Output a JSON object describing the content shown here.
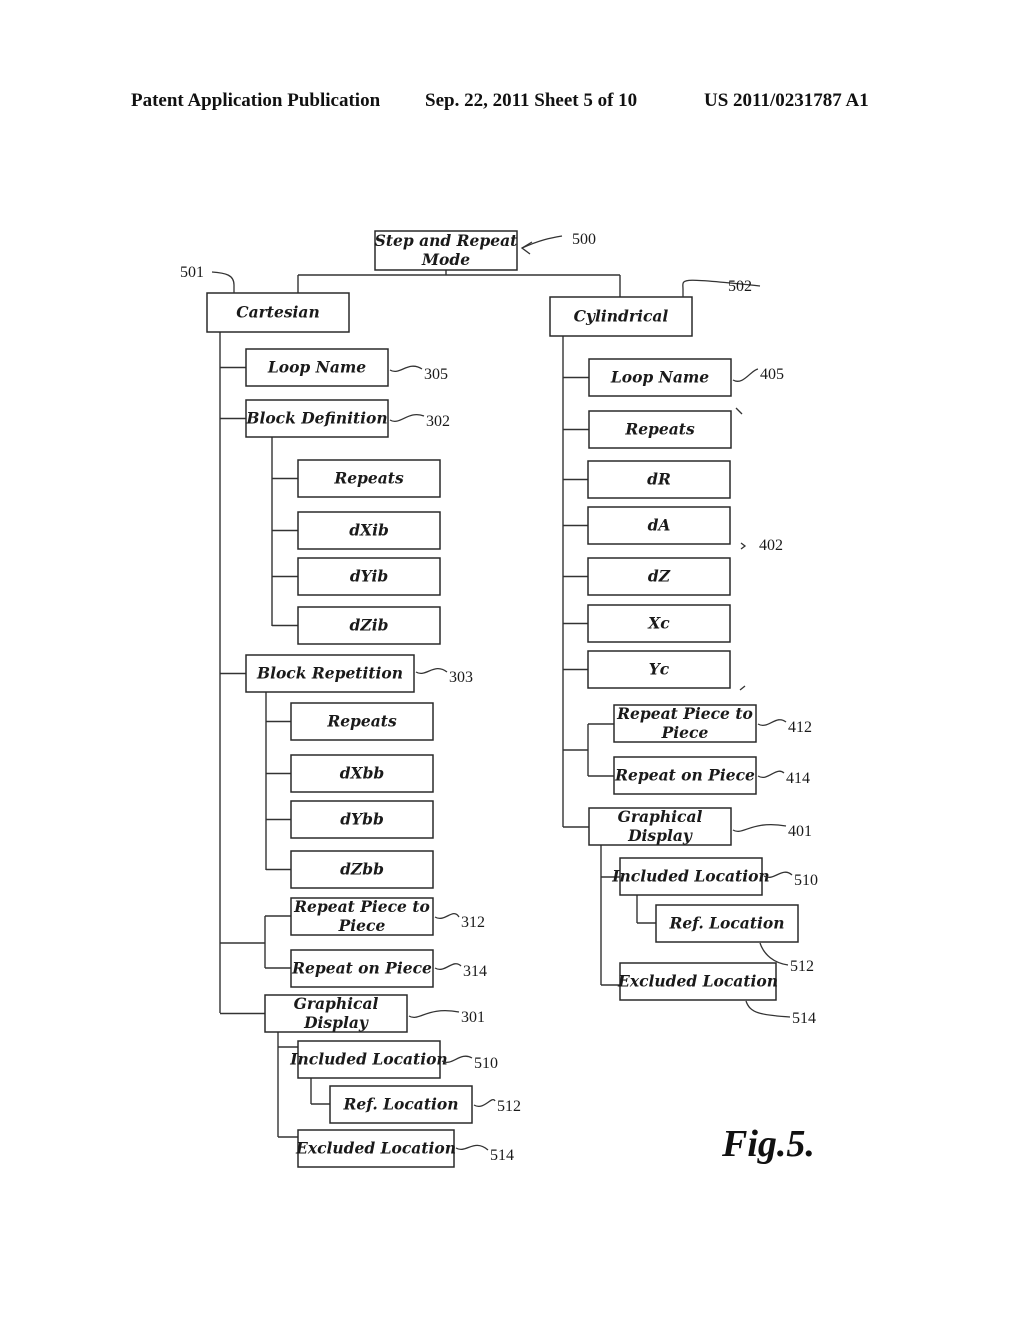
{
  "header": {
    "publication": "Patent Application Publication",
    "date_sheet": "Sep. 22, 2011   Sheet 5 of 10",
    "number": "US 2011/0231787 A1"
  },
  "figure_label": "Fig.5.",
  "diagram": {
    "root": {
      "id": "root",
      "lines": [
        "Step and Repeat",
        "Mode"
      ],
      "ref": "500"
    },
    "boxes": [
      {
        "id": "cart",
        "lines": [
          "Cartesian"
        ],
        "ref": "501"
      },
      {
        "id": "cyl",
        "lines": [
          "Cylindrical"
        ],
        "ref": "502"
      },
      {
        "id": "c-loop",
        "lines": [
          "Loop Name"
        ],
        "ref": "305"
      },
      {
        "id": "c-bdef",
        "lines": [
          "Block Definition"
        ],
        "ref": "302"
      },
      {
        "id": "c-bd-rep",
        "lines": [
          "Repeats"
        ],
        "ref": ""
      },
      {
        "id": "c-dxib",
        "lines": [
          "dXib"
        ],
        "ref": ""
      },
      {
        "id": "c-dyib",
        "lines": [
          "dYib"
        ],
        "ref": ""
      },
      {
        "id": "c-dzib",
        "lines": [
          "dZib"
        ],
        "ref": ""
      },
      {
        "id": "c-brep",
        "lines": [
          "Block Repetition"
        ],
        "ref": "303"
      },
      {
        "id": "c-br-rep",
        "lines": [
          "Repeats"
        ],
        "ref": ""
      },
      {
        "id": "c-dxbb",
        "lines": [
          "dXbb"
        ],
        "ref": ""
      },
      {
        "id": "c-dybb",
        "lines": [
          "dYbb"
        ],
        "ref": ""
      },
      {
        "id": "c-dzbb",
        "lines": [
          "dZbb"
        ],
        "ref": ""
      },
      {
        "id": "c-rp2p",
        "lines": [
          "Repeat Piece to",
          "Piece"
        ],
        "ref": "312"
      },
      {
        "id": "c-rop",
        "lines": [
          "Repeat on Piece"
        ],
        "ref": "314"
      },
      {
        "id": "c-gd",
        "lines": [
          "Graphical",
          "Display"
        ],
        "ref": "301"
      },
      {
        "id": "c-incl",
        "lines": [
          "Included Location"
        ],
        "ref": "510"
      },
      {
        "id": "c-refl",
        "lines": [
          "Ref. Location"
        ],
        "ref": "512"
      },
      {
        "id": "c-excl",
        "lines": [
          "Excluded Location"
        ],
        "ref": "514"
      },
      {
        "id": "y-loop",
        "lines": [
          "Loop Name"
        ],
        "ref": "405"
      },
      {
        "id": "y-rep",
        "lines": [
          "Repeats"
        ],
        "ref": ""
      },
      {
        "id": "y-dr",
        "lines": [
          "dR"
        ],
        "ref": ""
      },
      {
        "id": "y-da",
        "lines": [
          "dA"
        ],
        "ref": ""
      },
      {
        "id": "y-dz",
        "lines": [
          "dZ"
        ],
        "ref": ""
      },
      {
        "id": "y-xc",
        "lines": [
          "Xc"
        ],
        "ref": ""
      },
      {
        "id": "y-yc",
        "lines": [
          "Yc"
        ],
        "ref": ""
      },
      {
        "id": "y-rp2p",
        "lines": [
          "Repeat Piece to",
          "Piece"
        ],
        "ref": "412"
      },
      {
        "id": "y-rop",
        "lines": [
          "Repeat on Piece"
        ],
        "ref": "414"
      },
      {
        "id": "y-gd",
        "lines": [
          "Graphical",
          "Display"
        ],
        "ref": "401"
      },
      {
        "id": "y-incl",
        "lines": [
          "Included Location"
        ],
        "ref": "510"
      },
      {
        "id": "y-refl",
        "lines": [
          "Ref. Location"
        ],
        "ref": "512"
      },
      {
        "id": "y-excl",
        "lines": [
          "Excluded Location"
        ],
        "ref": "514"
      }
    ],
    "group_ref": {
      "label": "402",
      "members": [
        "y-rep",
        "y-dr",
        "y-da",
        "y-dz",
        "y-xc",
        "y-yc"
      ]
    }
  }
}
